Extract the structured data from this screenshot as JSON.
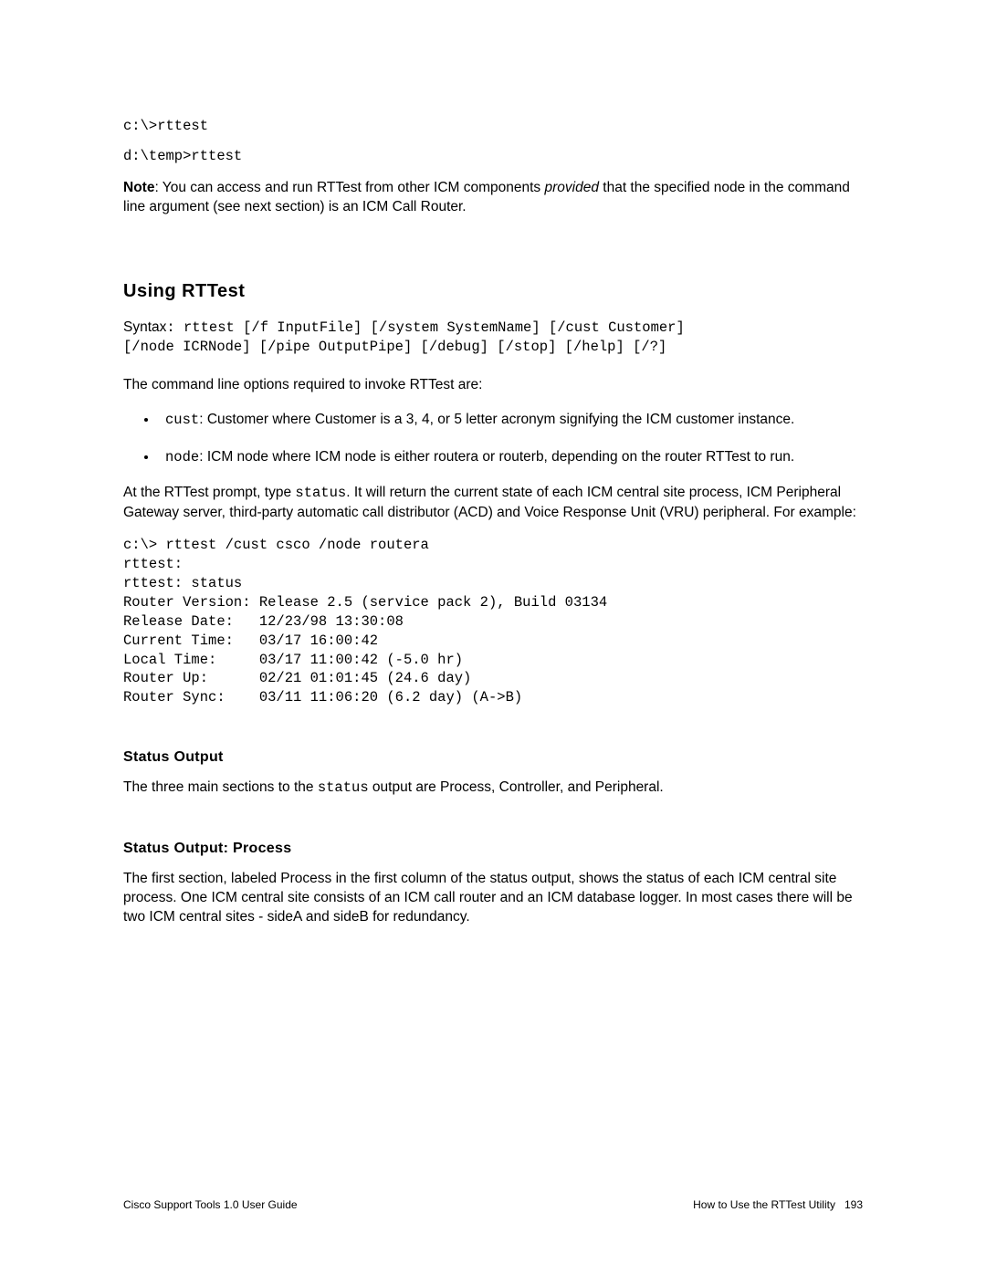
{
  "code_line_1": "c:\\>rttest",
  "code_line_2": "d:\\temp>rttest",
  "note": {
    "label": "Note",
    "text_before_italic": ": You can access and run RTTest from other ICM components ",
    "italic_word": "provided",
    "text_after_italic": " that the specified node in the command line argument (see next section) is an ICM Call Router."
  },
  "h2_using": "Using RTTest",
  "syntax": {
    "label": "Syntax",
    "line1": ": rttest [/f InputFile] [/system SystemName] [/cust Customer]",
    "line2": "[/node ICRNode] [/pipe OutputPipe] [/debug] [/stop] [/help] [/?]"
  },
  "cmdline_intro": "The command line options required to invoke RTTest are:",
  "bullets": {
    "cust_code": "cust",
    "cust_text": ": Customer where Customer is a 3, 4, or 5 letter acronym signifying the ICM customer instance.",
    "node_code": "node",
    "node_text": ": ICM node where ICM node is either routera or routerb, depending on the router RTTest to run."
  },
  "prompt_para": {
    "before_code": "At the RTTest prompt, type ",
    "code": "status",
    "after_code": ". It will return the current state of each ICM central site process, ICM Peripheral Gateway server, third-party automatic call distributor (ACD) and Voice Response Unit (VRU) peripheral. For example:"
  },
  "terminal_output": "c:\\> rttest /cust csco /node routera\nrttest:\nrttest: status\nRouter Version: Release 2.5 (service pack 2), Build 03134\nRelease Date:   12/23/98 13:30:08\nCurrent Time:   03/17 16:00:42\nLocal Time:     03/17 11:00:42 (-5.0 hr)\nRouter Up:      02/21 01:01:45 (24.6 day)\nRouter Sync:    03/11 11:06:20 (6.2 day) (A->B)",
  "h3_status_output": "Status Output",
  "status_output_para": {
    "before_code": "The three main sections to the ",
    "code": "status",
    "after_code": " output are Process, Controller, and Peripheral."
  },
  "h3_process": "Status Output: Process",
  "process_para": "The first section, labeled Process in the first column of the status output, shows the status of each ICM central site process. One ICM central site consists of an ICM call router and an ICM database logger. In most cases there will be two ICM central sites - sideA and sideB for redundancy.",
  "footer": {
    "left": "Cisco Support Tools 1.0 User Guide",
    "right_text": "How to Use the RTTest Utility",
    "page_num": "193"
  }
}
